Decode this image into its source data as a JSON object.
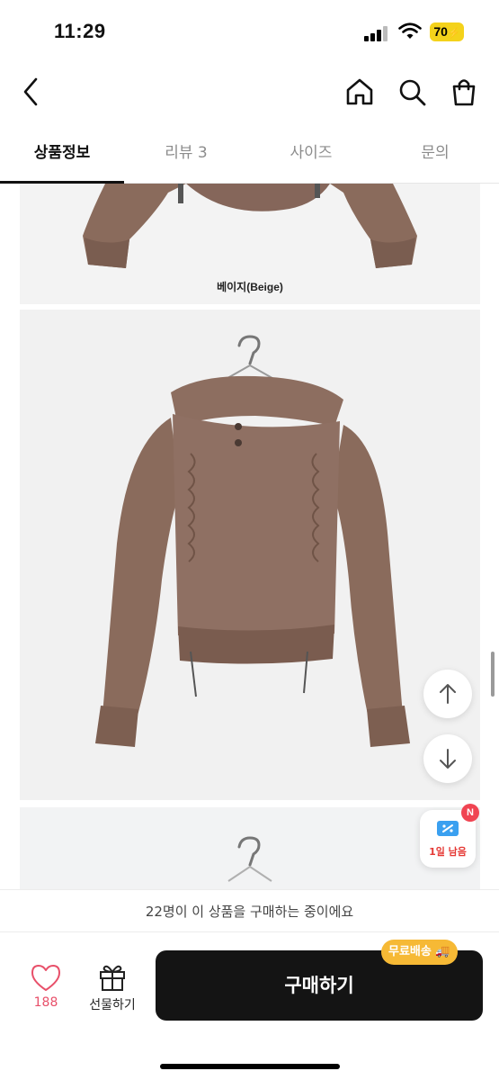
{
  "status_bar": {
    "time": "11:29",
    "battery": "70"
  },
  "header": {
    "icons": [
      "back-icon",
      "home-icon",
      "search-icon",
      "cart-icon"
    ]
  },
  "tabs": [
    {
      "label": "상품정보",
      "active": true
    },
    {
      "label": "리뷰 3",
      "active": false
    },
    {
      "label": "사이즈",
      "active": false
    },
    {
      "label": "문의",
      "active": false
    }
  ],
  "product_images": {
    "caption": "베이지(Beige)",
    "garment_color": "#8a6b5c"
  },
  "floating": {
    "coupon_label": "1일 남음",
    "coupon_badge": "N"
  },
  "notice": {
    "text": "22명이 이 상품을 구매하는 중이에요"
  },
  "bottom_bar": {
    "like_count": "188",
    "gift_label": "선물하기",
    "buy_label": "구매하기",
    "shipping_badge": "무료배송"
  },
  "colors": {
    "accent_like": "#e8506a",
    "buy_button": "#141414",
    "shipping_badge": "#f6b935"
  }
}
